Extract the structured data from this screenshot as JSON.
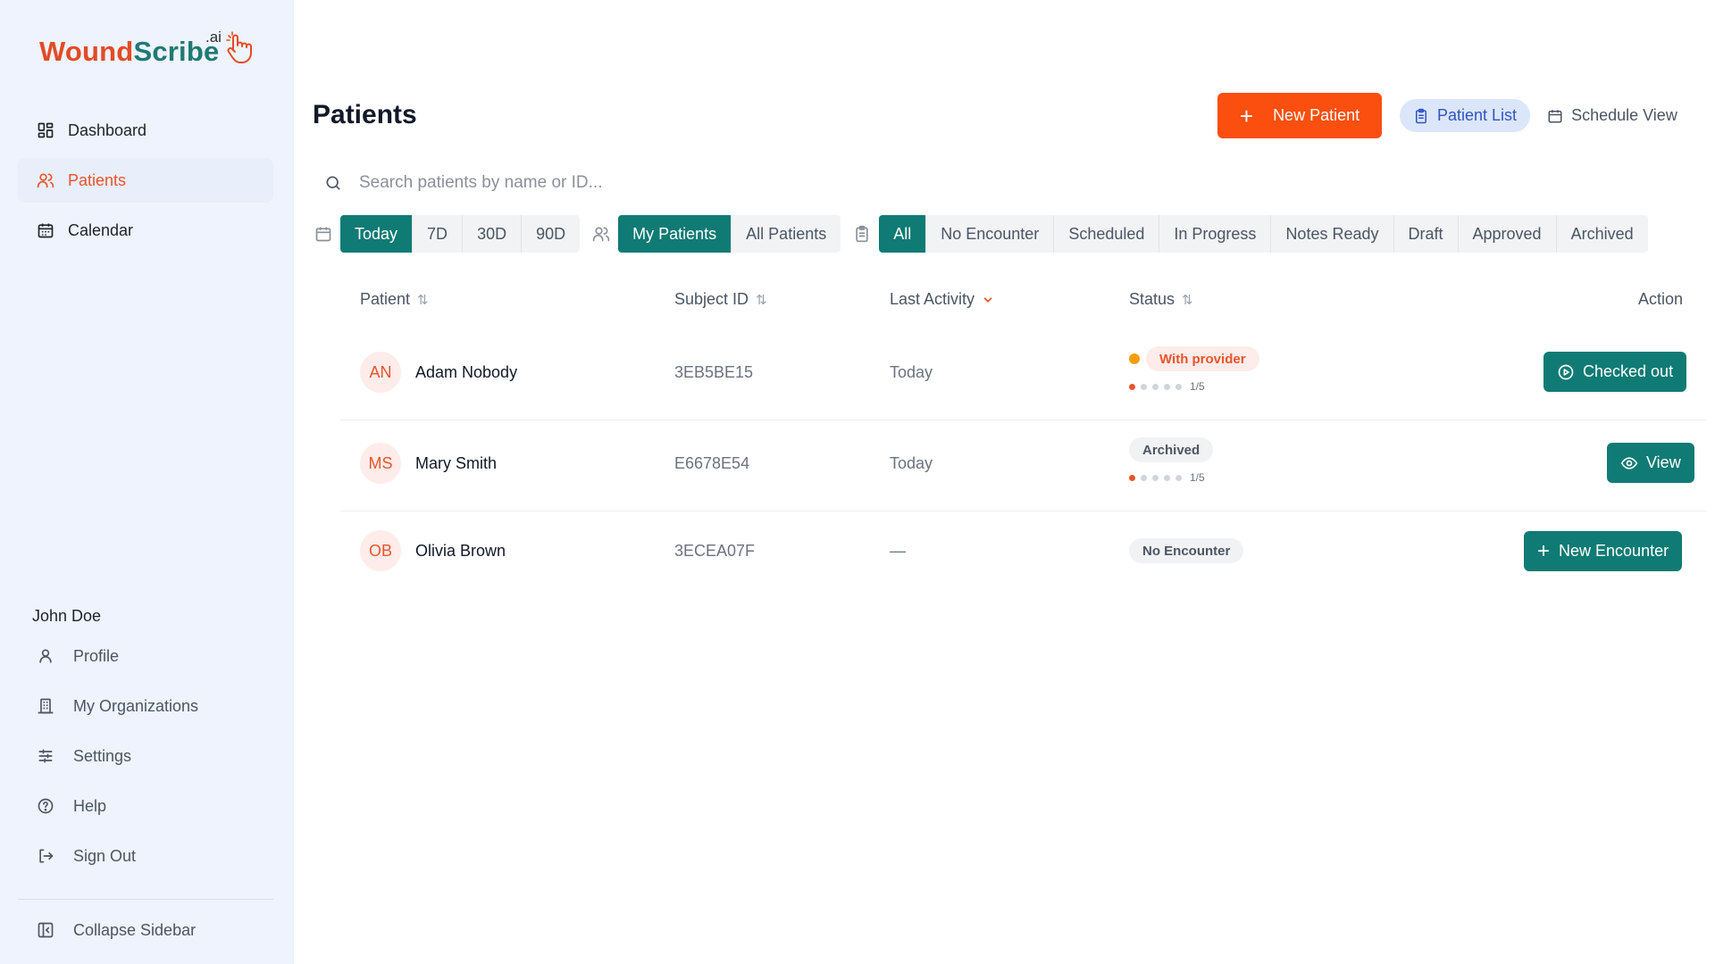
{
  "brand": {
    "name_part1": "Wound",
    "name_part2": "Scribe",
    "suffix": ".ai",
    "color_orange": "#e34b24",
    "color_teal": "#1f7a74"
  },
  "sidebar": {
    "nav": [
      {
        "label": "Dashboard",
        "icon": "dashboard-grid-icon",
        "active": false
      },
      {
        "label": "Patients",
        "icon": "users-icon",
        "active": true
      },
      {
        "label": "Calendar",
        "icon": "calendar-icon",
        "active": false
      }
    ],
    "user_name": "John Doe",
    "account": [
      {
        "label": "Profile",
        "icon": "user-icon"
      },
      {
        "label": "My Organizations",
        "icon": "building-icon"
      },
      {
        "label": "Settings",
        "icon": "sliders-icon"
      },
      {
        "label": "Help",
        "icon": "help-circle-icon"
      },
      {
        "label": "Sign Out",
        "icon": "sign-out-icon"
      }
    ],
    "collapse_label": "Collapse Sidebar"
  },
  "header": {
    "title": "Patients",
    "new_patient_label": "New Patient",
    "view_patient_list": "Patient List",
    "view_schedule": "Schedule View"
  },
  "search": {
    "placeholder": "Search patients by name or ID..."
  },
  "filters": {
    "date": [
      "Today",
      "7D",
      "30D",
      "90D"
    ],
    "date_selected": "Today",
    "owner": [
      "My Patients",
      "All Patients"
    ],
    "owner_selected": "My Patients",
    "status": [
      "All",
      "No Encounter",
      "Scheduled",
      "In Progress",
      "Notes Ready",
      "Draft",
      "Approved",
      "Archived"
    ],
    "status_selected": "All"
  },
  "table": {
    "columns": {
      "patient": "Patient",
      "subject_id": "Subject ID",
      "last_activity": "Last Activity",
      "status": "Status",
      "action": "Action"
    },
    "sort_indicator": "⇅",
    "rows": [
      {
        "initials": "AN",
        "name": "Adam Nobody",
        "subject_id": "3EB5BE15",
        "last_activity": "Today",
        "status": "With provider",
        "progress": "1/5",
        "progress_value": 1,
        "action": "Checked out"
      },
      {
        "initials": "MS",
        "name": "Mary Smith",
        "subject_id": "E6678E54",
        "last_activity": "Today",
        "status": "Archived",
        "progress": "1/5",
        "progress_value": 1,
        "action": "View"
      },
      {
        "initials": "OB",
        "name": "Olivia Brown",
        "subject_id": "3ECEA07F",
        "last_activity": "—",
        "status": "No Encounter",
        "progress": null,
        "action": "New Encounter"
      }
    ]
  },
  "colors": {
    "primary_teal": "#0f7b74",
    "accent_orange": "#fa4f0f",
    "sidebar_bg": "#eef3fd"
  }
}
